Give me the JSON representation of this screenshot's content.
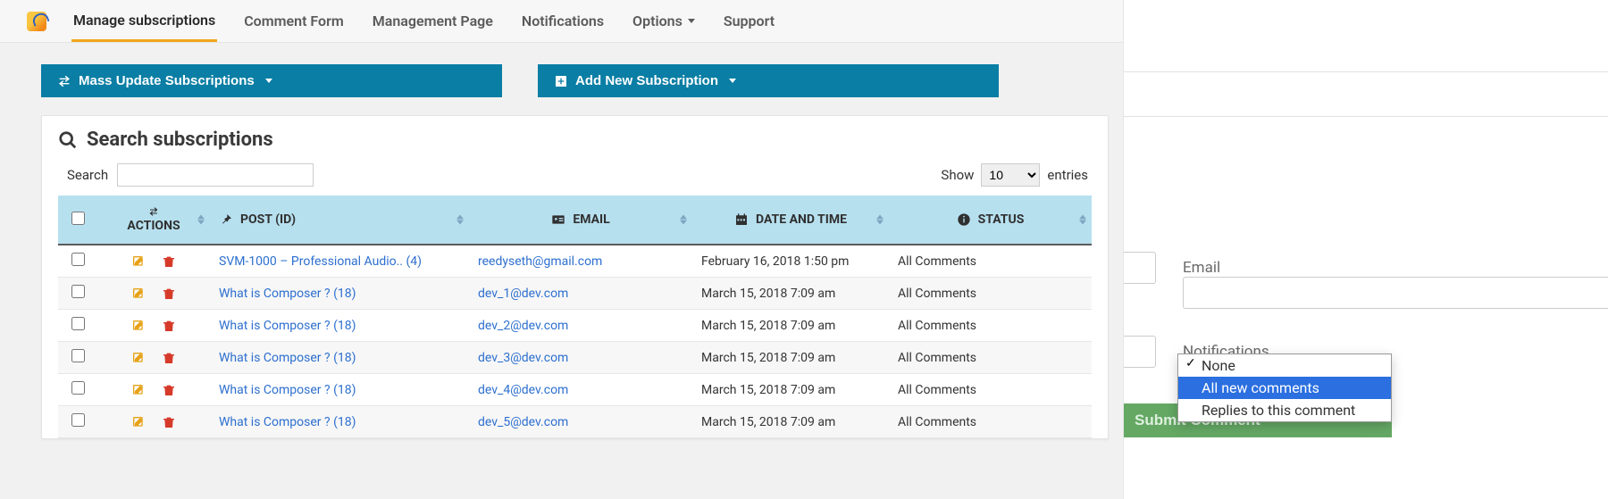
{
  "nav": {
    "items": [
      {
        "label": "Manage subscriptions",
        "active": true
      },
      {
        "label": "Comment Form",
        "active": false
      },
      {
        "label": "Management Page",
        "active": false
      },
      {
        "label": "Notifications",
        "active": false
      },
      {
        "label": "Options",
        "active": false,
        "dropdown": true
      },
      {
        "label": "Support",
        "active": false
      }
    ]
  },
  "buttons": {
    "mass_update": "Mass Update Subscriptions",
    "add_new": "Add New Subscription"
  },
  "panel": {
    "title": "Search subscriptions",
    "search_label": "Search",
    "show_label": "Show",
    "entries_label": "entries",
    "entries_value": "10"
  },
  "table": {
    "headers": {
      "actions": "ACTIONS",
      "post": "POST (ID)",
      "email": "EMAIL",
      "date": "DATE AND TIME",
      "status": "STATUS"
    },
    "rows": [
      {
        "post": "SVM-1000 – Professional Audio.. (4)",
        "email": "reedyseth@gmail.com",
        "date": "February 16, 2018 1:50 pm",
        "status": "All Comments"
      },
      {
        "post": "What is Composer ? (18)",
        "email": "dev_1@dev.com",
        "date": "March 15, 2018 7:09 am",
        "status": "All Comments"
      },
      {
        "post": "What is Composer ? (18)",
        "email": "dev_2@dev.com",
        "date": "March 15, 2018 7:09 am",
        "status": "All Comments"
      },
      {
        "post": "What is Composer ? (18)",
        "email": "dev_3@dev.com",
        "date": "March 15, 2018 7:09 am",
        "status": "All Comments"
      },
      {
        "post": "What is Composer ? (18)",
        "email": "dev_4@dev.com",
        "date": "March 15, 2018 7:09 am",
        "status": "All Comments"
      },
      {
        "post": "What is Composer ? (18)",
        "email": "dev_5@dev.com",
        "date": "March 15, 2018 7:09 am",
        "status": "All Comments"
      }
    ]
  },
  "form_preview": {
    "email_label": "Email",
    "notifications_label": "Notifications",
    "submit_label": "Submit Comment",
    "options": [
      {
        "label": "None",
        "checked": true,
        "selected": false
      },
      {
        "label": "All new comments",
        "checked": false,
        "selected": true
      },
      {
        "label": "Replies to this comment",
        "checked": false,
        "selected": false
      }
    ]
  }
}
